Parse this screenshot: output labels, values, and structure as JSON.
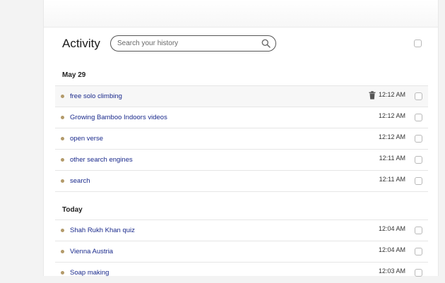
{
  "header": {
    "title": "Activity",
    "search_placeholder": "Search your history",
    "search_value": ""
  },
  "sections": [
    {
      "heading": "May 29",
      "items": [
        {
          "title": "free solo climbing",
          "time": "12:12 AM",
          "hovered": true
        },
        {
          "title": "Growing Bamboo Indoors videos",
          "time": "12:12 AM"
        },
        {
          "title": "open verse",
          "time": "12:12 AM"
        },
        {
          "title": "other search engines",
          "time": "12:11 AM"
        },
        {
          "title": "search",
          "time": "12:11 AM"
        }
      ]
    },
    {
      "heading": "Today",
      "items": [
        {
          "title": "Shah Rukh Khan quiz",
          "time": "12:04 AM"
        },
        {
          "title": "Vienna Austria",
          "time": "12:04 AM"
        },
        {
          "title": "Soap making",
          "time": "12:03 AM"
        }
      ]
    }
  ],
  "icons": {
    "search": "search-icon",
    "delete": "trash-icon",
    "bullet": "dot-icon"
  },
  "colors": {
    "link": "#1a2a8c",
    "bullet": "#b39a6a",
    "background": "#f3f3f3"
  }
}
